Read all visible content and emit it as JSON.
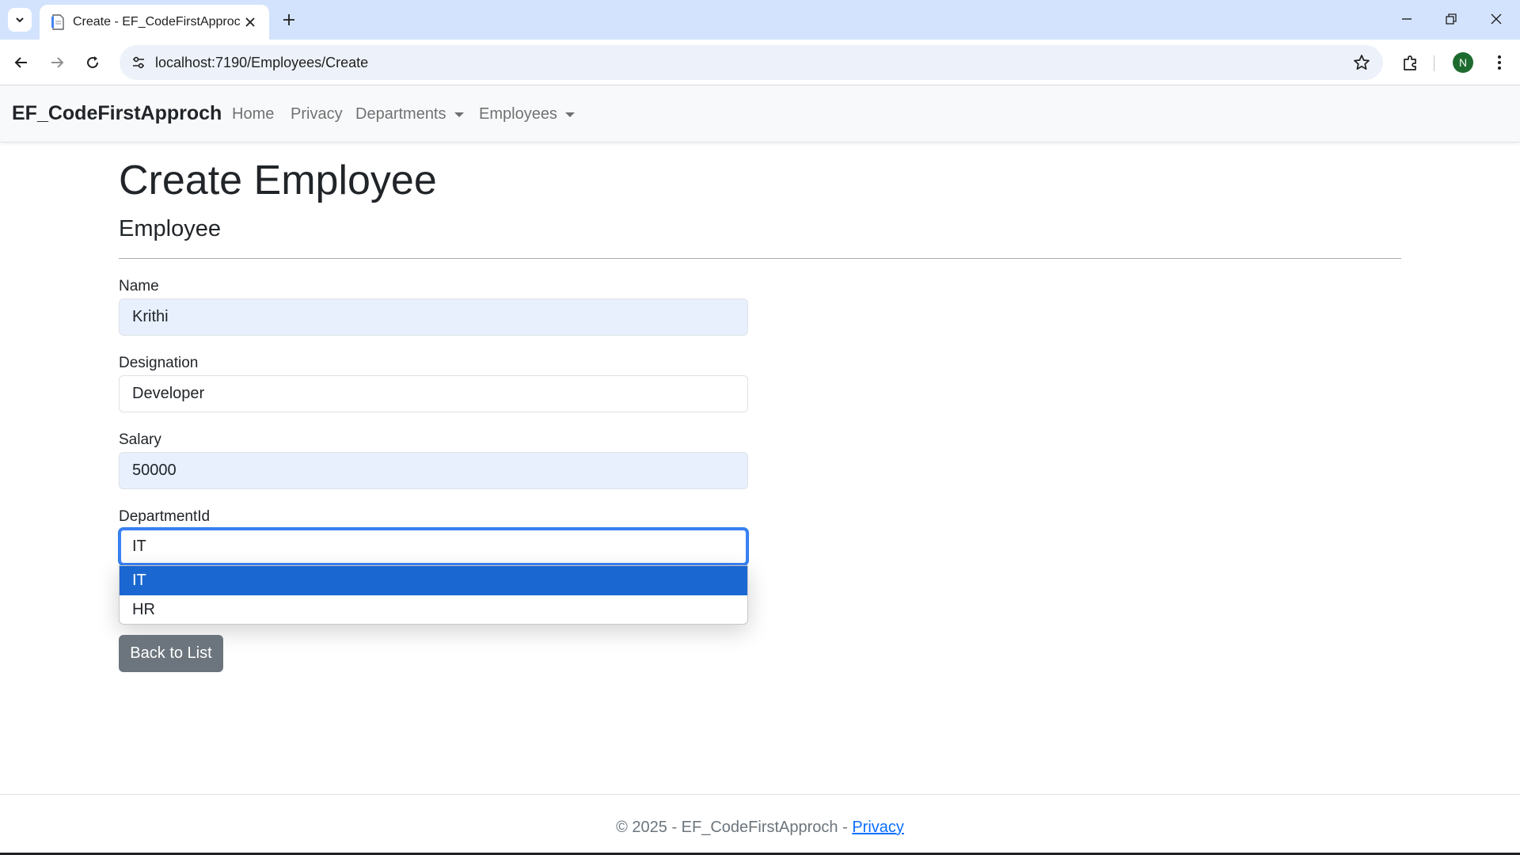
{
  "browser": {
    "tab": {
      "title": "Create - EF_CodeFirstApproch"
    },
    "url": "localhost:7190/Employees/Create",
    "profile_initial": "N"
  },
  "navbar": {
    "brand": "EF_CodeFirstApproch",
    "links": [
      {
        "label": "Home"
      },
      {
        "label": "Privacy"
      },
      {
        "label": "Departments"
      },
      {
        "label": "Employees"
      }
    ]
  },
  "page": {
    "title": "Create Employee",
    "subtitle": "Employee"
  },
  "form": {
    "name": {
      "label": "Name",
      "value": "Krithi"
    },
    "designation": {
      "label": "Designation",
      "value": "Developer"
    },
    "salary": {
      "label": "Salary",
      "value": "50000"
    },
    "department": {
      "label": "DepartmentId",
      "value": "IT",
      "options": [
        "IT",
        "HR"
      ],
      "highlighted": "IT"
    }
  },
  "actions": {
    "back": "Back to List"
  },
  "footer": {
    "text": "© 2025 - EF_CodeFirstApproch - ",
    "link": "Privacy"
  },
  "colors": {
    "tabstrip": "#d3e3fd",
    "selected_option": "#1a67d2",
    "secondary_button": "#6c757d",
    "link": "#0d6efd",
    "autofill": "#e8f0fe"
  },
  "icons": {
    "tab_list": "chevron-down-icon",
    "favicon": "document-icon",
    "tab_close": "close-icon",
    "new_tab": "plus-icon",
    "back": "arrow-left-icon",
    "forward": "arrow-right-icon",
    "reload": "reload-icon",
    "site_info": "tune-icon",
    "bookmark": "star-icon",
    "extensions": "puzzle-icon",
    "menu": "kebab-menu-icon"
  }
}
